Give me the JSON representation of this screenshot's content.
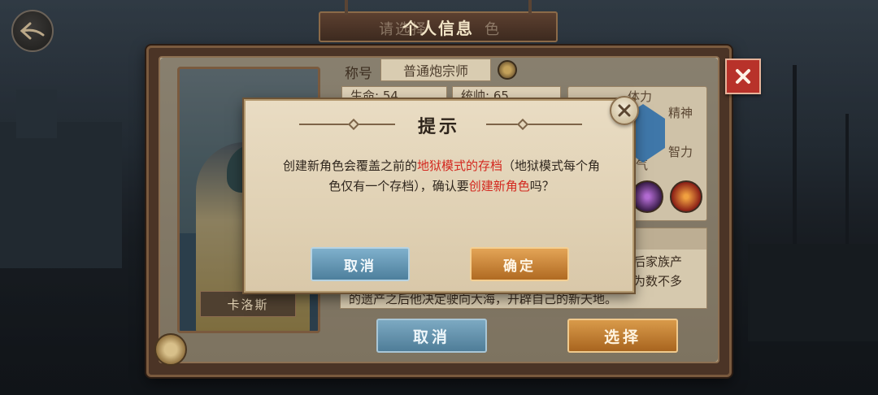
{
  "header": {
    "title": "个人信息",
    "tab_hint_left": "请选择",
    "tab_hint_right": "色"
  },
  "character": {
    "name": "卡洛斯",
    "title_label": "称号",
    "title_value": "普通炮宗师",
    "stats": [
      {
        "label": "生命",
        "value": "54"
      },
      {
        "label": "统帅",
        "value": "65"
      }
    ],
    "attributes": [
      "体力",
      "精神",
      "智力",
      "气"
    ],
    "story_lines": [
      "后家族产",
      "为数不多",
      "的遗产之后他决定驶向大海，开辟自己的新天地。"
    ]
  },
  "buttons": {
    "cancel": "取消",
    "select": "选择"
  },
  "dialog": {
    "title": "提示",
    "message_part1": "创建新角色会覆盖之前的",
    "message_highlight1": "地狱模式的存档",
    "message_part2": "（地狱模式每个角色仅有一个存档），确认要",
    "message_highlight2": "创建新角色",
    "message_part3": "吗？",
    "cancel_label": "取消",
    "confirm_label": "确定"
  },
  "colors": {
    "highlight": "#d3281f",
    "cancel_blue": "#5d8ead",
    "confirm_orange": "#c27a2c",
    "close_red": "#b8322a"
  }
}
